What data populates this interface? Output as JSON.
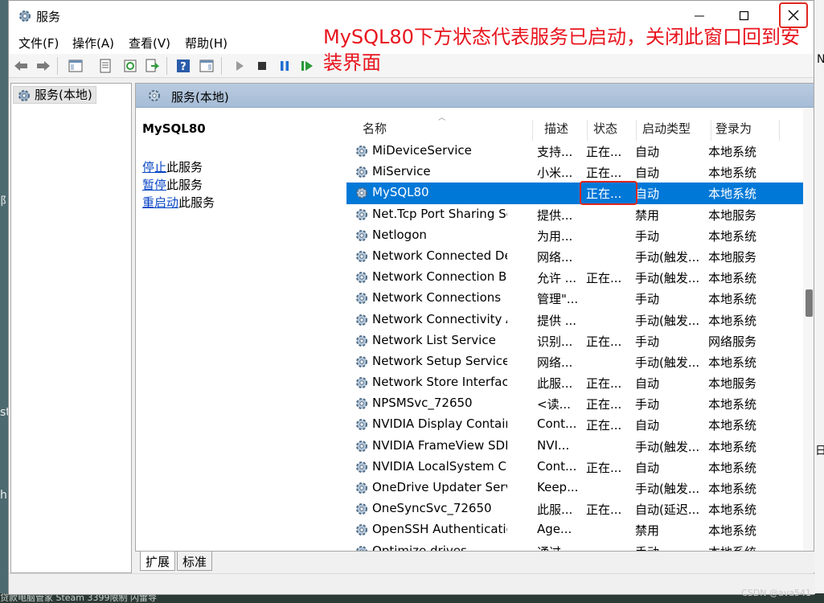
{
  "window": {
    "title": "服务"
  },
  "menu": [
    "文件(F)",
    "操作(A)",
    "查看(V)",
    "帮助(H)"
  ],
  "annotation": {
    "text": "MySQL80下方状态代表服务已启动，关闭此窗口回到安装界面"
  },
  "tree": {
    "root_label": "服务(本地)"
  },
  "pane": {
    "header": "服务(本地)"
  },
  "detail": {
    "service_name": "MySQL80",
    "actions": [
      {
        "link": "停止",
        "suffix": "此服务"
      },
      {
        "link": "暂停",
        "suffix": "此服务"
      },
      {
        "link": "重启动",
        "suffix": "此服务"
      }
    ]
  },
  "columns": {
    "name": "名称",
    "desc": "描述",
    "status": "状态",
    "startup": "启动类型",
    "logon": "登录为"
  },
  "services": [
    {
      "name": "MiDeviceService",
      "desc": "支持...",
      "status": "正在...",
      "startup": "自动",
      "logon": "本地系统"
    },
    {
      "name": "MiService",
      "desc": "小米...",
      "status": "正在...",
      "startup": "自动",
      "logon": "本地系统"
    },
    {
      "name": "MySQL80",
      "desc": "",
      "status": "正在...",
      "startup": "自动",
      "logon": "本地系统",
      "selected": true
    },
    {
      "name": "Net.Tcp Port Sharing Service",
      "desc": "提供...",
      "status": "",
      "startup": "禁用",
      "logon": "本地服务"
    },
    {
      "name": "Netlogon",
      "desc": "为用...",
      "status": "",
      "startup": "手动",
      "logon": "本地系统"
    },
    {
      "name": "Network Connected Devic...",
      "desc": "网络...",
      "status": "",
      "startup": "手动(触发...",
      "logon": "本地服务"
    },
    {
      "name": "Network Connection Broker",
      "desc": "允许 ...",
      "status": "正在...",
      "startup": "手动(触发...",
      "logon": "本地系统"
    },
    {
      "name": "Network Connections",
      "desc": "管理\"...",
      "status": "",
      "startup": "手动",
      "logon": "本地系统"
    },
    {
      "name": "Network Connectivity Assis...",
      "desc": "提供 ...",
      "status": "",
      "startup": "手动(触发...",
      "logon": "本地系统"
    },
    {
      "name": "Network List Service",
      "desc": "识别...",
      "status": "正在...",
      "startup": "手动",
      "logon": "网络服务"
    },
    {
      "name": "Network Setup Service",
      "desc": "网络...",
      "status": "",
      "startup": "手动(触发...",
      "logon": "本地系统"
    },
    {
      "name": "Network Store Interface Se...",
      "desc": "此服...",
      "status": "正在...",
      "startup": "自动",
      "logon": "本地服务"
    },
    {
      "name": "NPSMSvc_72650",
      "desc": "<读...",
      "status": "正在...",
      "startup": "手动",
      "logon": "本地系统"
    },
    {
      "name": "NVIDIA Display Container LS",
      "desc": "Cont...",
      "status": "正在...",
      "startup": "自动",
      "logon": "本地系统"
    },
    {
      "name": "NVIDIA FrameView SDK se...",
      "desc": "NVI...",
      "status": "",
      "startup": "手动(触发...",
      "logon": "本地系统"
    },
    {
      "name": "NVIDIA LocalSystem Conta...",
      "desc": "Cont...",
      "status": "正在...",
      "startup": "自动",
      "logon": "本地系统"
    },
    {
      "name": "OneDrive Updater Service",
      "desc": "Keep...",
      "status": "",
      "startup": "手动(触发...",
      "logon": "本地系统"
    },
    {
      "name": "OneSyncSvc_72650",
      "desc": "此服...",
      "status": "正在...",
      "startup": "自动(延迟...",
      "logon": "本地系统"
    },
    {
      "name": "OpenSSH Authentication ...",
      "desc": "Age...",
      "status": "",
      "startup": "禁用",
      "logon": "本地系统"
    },
    {
      "name": "Optimize drives",
      "desc": "通过...",
      "status": "",
      "startup": "手动",
      "logon": "本地系统"
    }
  ],
  "tabs": [
    "扩展",
    "标准"
  ],
  "watermark": "CSDN @ava541",
  "desktop": {
    "taskbar_text": "贷款电脑管家        Steam        3399限制        闪雷导",
    "letter_a": "N",
    "letter_b": "阝",
    "letter_c": "st",
    "letter_d": "h",
    "letter_e": "日"
  }
}
